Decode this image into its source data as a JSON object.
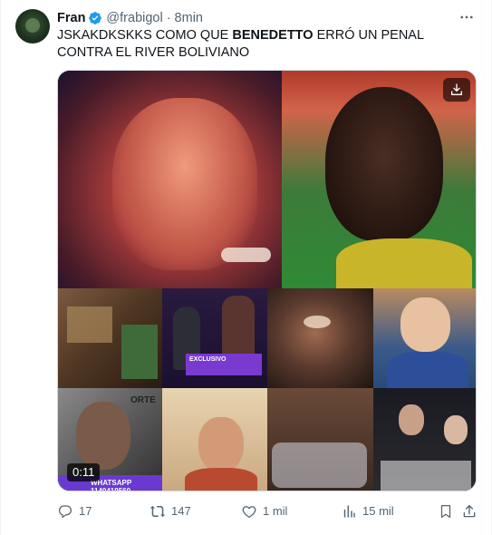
{
  "tweet": {
    "author_name": "Fran",
    "handle": "@frabigol",
    "separator": "·",
    "time": "8min",
    "text_before": "JSKAKDKSKKS COMO QUE ",
    "text_bold": "BENEDETTO",
    "text_after": " ERRÓ UN PENAL CONTRA EL RIVER BOLIVIANO"
  },
  "media": {
    "duration": "0:11",
    "overlay_exclusive": "EXCLUSIVO",
    "overlay_whatsapp": "WHATSAPP 1140419560",
    "overlay_portes": "ORTE"
  },
  "actions": {
    "replies": "17",
    "reposts": "147",
    "likes": "1 mil",
    "views": "15 mil"
  },
  "icons": {
    "verified": "verified-badge-icon",
    "more": "more-horizontal-icon",
    "download": "download-icon",
    "reply": "reply-icon",
    "repost": "repost-icon",
    "like": "heart-icon",
    "views": "views-icon",
    "bookmark": "bookmark-icon",
    "share": "share-icon"
  },
  "colors": {
    "verified": "#1d9bf0",
    "secondary_text": "#536471",
    "primary_text": "#0f1419"
  }
}
